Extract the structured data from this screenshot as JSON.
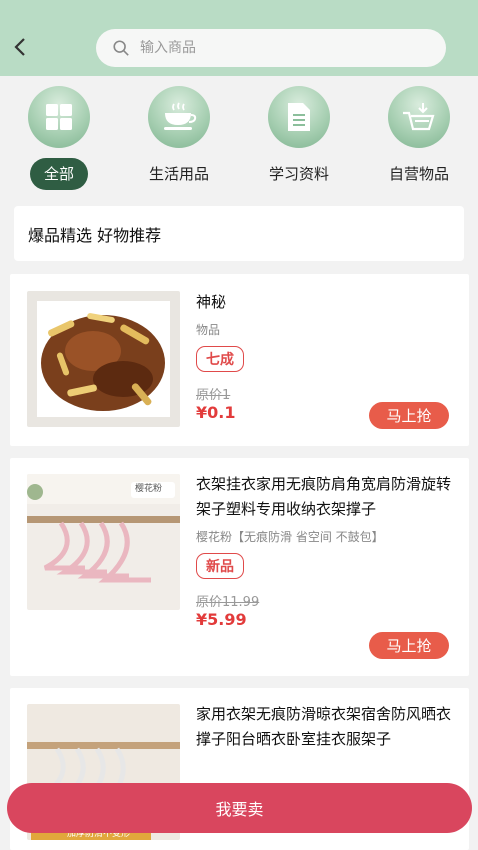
{
  "header": {
    "back_icon": "chevron-left-icon",
    "search_placeholder": "输入商品",
    "search_icon": "search-icon"
  },
  "categories": [
    {
      "label": "全部",
      "icon": "grid-icon",
      "active": true
    },
    {
      "label": "生活用品",
      "icon": "cup-icon",
      "active": false
    },
    {
      "label": "学习资料",
      "icon": "document-icon",
      "active": false
    },
    {
      "label": "自营物品",
      "icon": "basket-icon",
      "active": false
    }
  ],
  "recommend_title": "爆品精选 好物推荐",
  "products": [
    {
      "title": "神秘",
      "subtitle": "物品",
      "condition": "七成",
      "original_price": "原价1",
      "price": "¥0.1",
      "buy_label": "马上抢"
    },
    {
      "title": "衣架挂衣家用无痕防肩角宽肩防滑旋转架子塑料专用收纳衣架撑子",
      "subtitle": "樱花粉【无痕防滑 省空间 不鼓包】",
      "condition": "新品",
      "original_price": "原价11.99",
      "price": "¥5.99",
      "buy_label": "马上抢",
      "image_tag": "樱花粉"
    },
    {
      "title": "家用衣架无痕防滑晾衣架宿舍防风晒衣撑子阳台晒衣卧室挂衣服架子",
      "image_tag": "加厚防滑不变形"
    }
  ],
  "sell_button": "我要卖",
  "colors": {
    "header": "#b9dcc5",
    "active_category": "#2f5d43",
    "price": "#e23b3b",
    "buy_button": "#e85c4a",
    "sell_button": "#d9465e"
  }
}
